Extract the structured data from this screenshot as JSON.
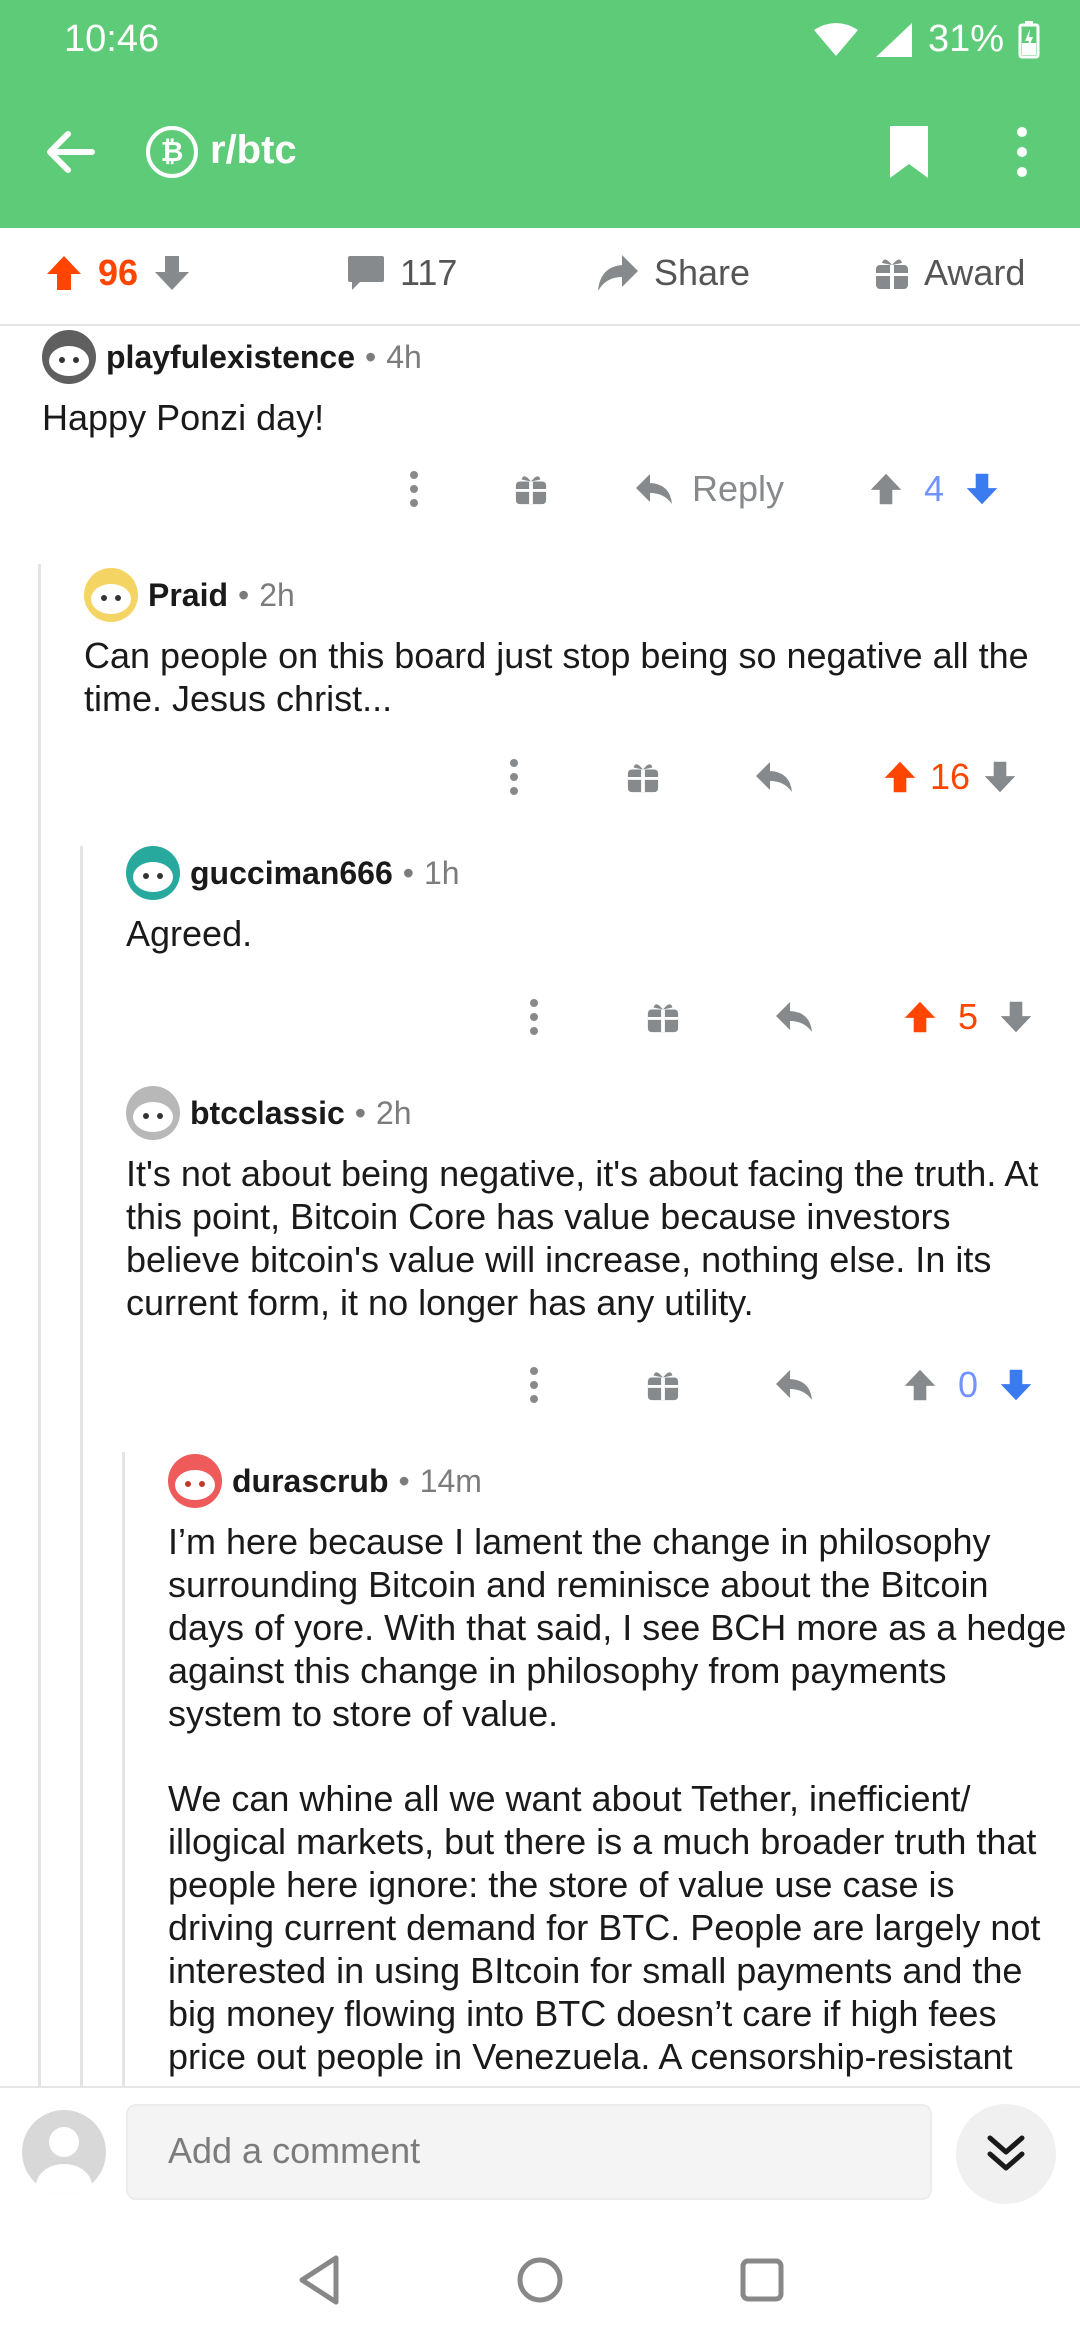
{
  "status_bar": {
    "time": "10:46",
    "battery": "31%"
  },
  "app_bar": {
    "subreddit": "r/btc",
    "badge_glyph": "₿"
  },
  "post_actions": {
    "score": "96",
    "comments": "117",
    "share_label": "Share",
    "award_label": "Award"
  },
  "comments": [
    {
      "user": "playfulexistence",
      "time": "4h",
      "body": [
        "Happy Ponzi day!"
      ],
      "reply_label": "Reply",
      "score": "4",
      "vote_state": "none"
    },
    {
      "user": "Praid",
      "time": "2h",
      "body": [
        "Can people on this board just stop being so negative all the time. Jesus christ..."
      ],
      "score": "16",
      "vote_state": "up"
    },
    {
      "user": "gucciman666",
      "time": "1h",
      "body": [
        "Agreed."
      ],
      "score": "5",
      "vote_state": "up"
    },
    {
      "user": "btcclassic",
      "time": "2h",
      "body": [
        "It's not about being negative, it's about facing the truth. At this point, Bitcoin Core has value because investors believe bitcoin's value will increase, nothing else. In its current form, it no longer has any utility."
      ],
      "score": "0",
      "vote_state": "none"
    },
    {
      "user": "durascrub",
      "time": "14m",
      "body": [
        "I’m here because I lament the change in philosophy surrounding Bitcoin and reminisce about the Bitcoin days of yore. With that said, I see BCH more as a hedge against this change in philosophy from payments system to store of value.",
        "We can whine all we want about Tether, inefficient/ illogical markets, but there is a much broader truth that people here ignore: the store of value use case is driving current demand for BTC. People are largely not interested in using BItcoin for small payments and the big money flowing into BTC doesn’t care if high fees price out people in Venezuela. A censorship-resistant"
      ]
    }
  ],
  "separator": "•",
  "comment_bar": {
    "placeholder": "Add a comment"
  },
  "colors": {
    "header": "#5ecb78",
    "upvote": "#ff4500",
    "downvote": "#7193ff",
    "muted": "#878a8c"
  }
}
